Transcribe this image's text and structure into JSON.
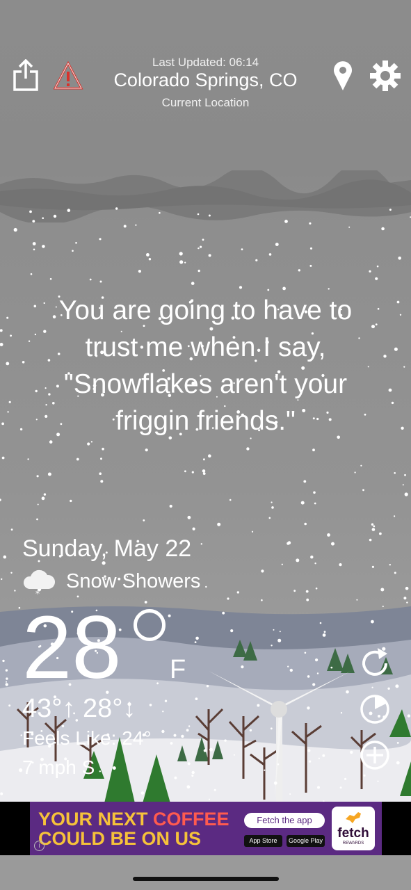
{
  "header": {
    "last_updated": "Last Updated: 06:14",
    "location": "Colorado Springs, CO",
    "location_sub": "Current Location",
    "icons": [
      "share-icon",
      "warning-icon",
      "location-pin-icon",
      "settings-gear-icon"
    ]
  },
  "quote": {
    "line1": "You are going to have to",
    "line2": "trust me when I say,",
    "line3": "\"Snowflakes aren't your",
    "line4": "friggin friends.\""
  },
  "weather": {
    "date": "Sunday, May 22",
    "condition": "Snow Showers",
    "condition_icon": "snow-cloud-icon",
    "temperature": "28",
    "unit": "F",
    "hilo": "43°↑ 28°↓",
    "feels_like": "Feels Like: 24°",
    "wind": "7 mph S"
  },
  "side_buttons": [
    "refresh-icon",
    "radar-icon",
    "add-icon"
  ],
  "ad": {
    "line1_a": "YOUR NEXT ",
    "line1_b": "COFFEE",
    "line2": "COULD BE ON US",
    "cta": "Fetch the app",
    "app_store": "App Store",
    "google_play": "Google Play",
    "brand": "fetch",
    "brand_sub": "REWARDS",
    "info": "i"
  },
  "colors": {
    "sky": "#8f8f8f",
    "ad_bg": "#5b2a82",
    "ad_text": "#f6c23a",
    "ad_highlight": "#ff5a4f",
    "warning": "#d8322b"
  }
}
